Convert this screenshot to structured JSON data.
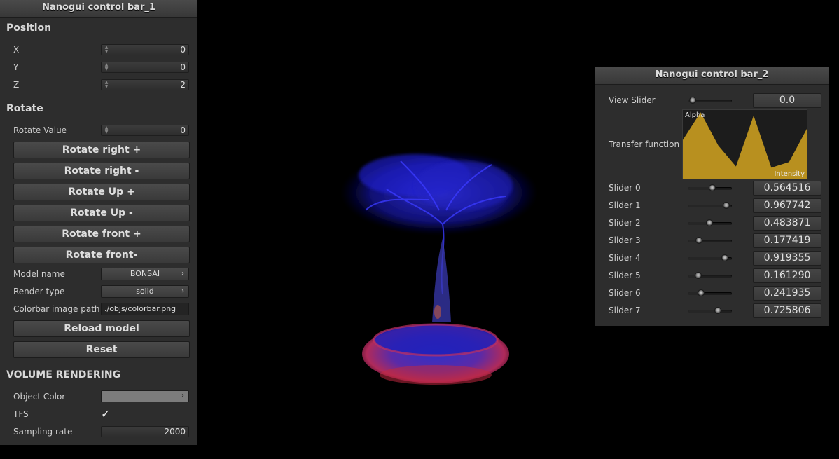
{
  "panel1": {
    "title": "Nanogui control bar_1",
    "position": {
      "heading": "Position",
      "fields": [
        {
          "label": "X",
          "value": "0"
        },
        {
          "label": "Y",
          "value": "0"
        },
        {
          "label": "Z",
          "value": "2"
        }
      ]
    },
    "rotate": {
      "heading": "Rotate",
      "value_label": "Rotate Value",
      "value": "0",
      "buttons": [
        "Rotate right +",
        "Rotate right -",
        "Rotate Up +",
        "Rotate Up -",
        "Rotate front +",
        "Rotate front-"
      ]
    },
    "model_name": {
      "label": "Model name",
      "value": "BONSAI"
    },
    "render_type": {
      "label": "Render type",
      "value": "solid"
    },
    "colorbar": {
      "label": "Colorbar image path",
      "value": "./objs/colorbar.png"
    },
    "reload_button": "Reload model",
    "reset_button": "Reset",
    "volume": {
      "heading": "VOLUME RENDERING",
      "object_color_label": "Object Color",
      "object_color": "#7c7c7c",
      "tfs_label": "TFS",
      "tfs_checked": true,
      "tfs_check_glyph": "✓",
      "sampling_label": "Sampling rate",
      "sampling_value": "2000"
    }
  },
  "panel2": {
    "title": "Nanogui control bar_2",
    "view_slider": {
      "label": "View Slider",
      "value": "0.0",
      "fraction": 0.0
    },
    "transfer_function": {
      "label": "Transfer function",
      "alpha_label": "Alpha",
      "intensity_label": "Intensity",
      "fill_color": "#b8901f",
      "points": [
        0.564516,
        0.967742,
        0.483871,
        0.177419,
        0.919355,
        0.16129,
        0.241935,
        0.725806
      ]
    },
    "sliders": [
      {
        "label": "Slider 0",
        "value": "0.564516",
        "fraction": 0.564516
      },
      {
        "label": "Slider 1",
        "value": "0.967742",
        "fraction": 0.967742
      },
      {
        "label": "Slider 2",
        "value": "0.483871",
        "fraction": 0.483871
      },
      {
        "label": "Slider 3",
        "value": "0.177419",
        "fraction": 0.177419
      },
      {
        "label": "Slider 4",
        "value": "0.919355",
        "fraction": 0.919355
      },
      {
        "label": "Slider 5",
        "value": "0.161290",
        "fraction": 0.16129
      },
      {
        "label": "Slider 6",
        "value": "0.241935",
        "fraction": 0.241935
      },
      {
        "label": "Slider 7",
        "value": "0.725806",
        "fraction": 0.725806
      }
    ]
  }
}
